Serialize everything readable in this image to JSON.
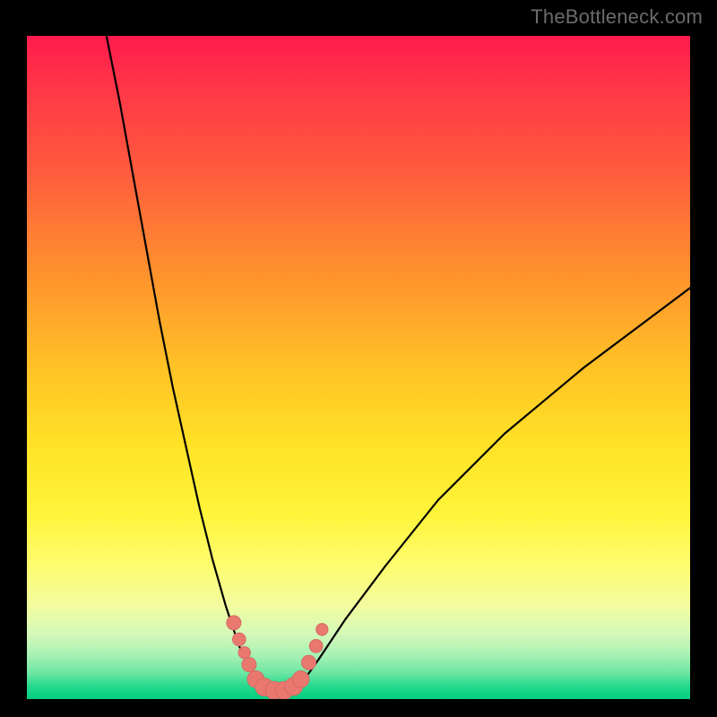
{
  "watermark": "TheBottleneck.com",
  "colors": {
    "curve": "#000000",
    "markers_fill": "#e9786f",
    "markers_stroke": "#d66a63",
    "background_black": "#000000"
  },
  "chart_data": {
    "type": "line",
    "title": "",
    "xlabel": "",
    "ylabel": "",
    "xlim": [
      0,
      100
    ],
    "ylim": [
      0,
      100
    ],
    "grid": false,
    "legend": false,
    "series": [
      {
        "name": "left-branch",
        "x": [
          12,
          14,
          16,
          18,
          20,
          22,
          24,
          26,
          28,
          30,
          31,
          32,
          33,
          34,
          34.5
        ],
        "y": [
          100,
          90,
          79,
          68,
          57,
          47,
          38,
          29,
          21,
          14,
          11,
          8,
          6,
          4,
          2.5
        ]
      },
      {
        "name": "valley-floor",
        "x": [
          34.5,
          36,
          38,
          40,
          41.5
        ],
        "y": [
          2.5,
          1.2,
          1.0,
          1.2,
          2.5
        ]
      },
      {
        "name": "right-branch",
        "x": [
          41.5,
          44,
          48,
          54,
          62,
          72,
          84,
          100
        ],
        "y": [
          2.5,
          6,
          12,
          20,
          30,
          40,
          50,
          62
        ]
      }
    ],
    "markers": [
      {
        "x": 31.2,
        "y": 11.5,
        "r": 1.2
      },
      {
        "x": 32.0,
        "y": 9.0,
        "r": 1.1
      },
      {
        "x": 32.8,
        "y": 7.0,
        "r": 1.0
      },
      {
        "x": 33.5,
        "y": 5.2,
        "r": 1.2
      },
      {
        "x": 34.5,
        "y": 3.0,
        "r": 1.4
      },
      {
        "x": 35.8,
        "y": 1.8,
        "r": 1.5
      },
      {
        "x": 37.3,
        "y": 1.3,
        "r": 1.5
      },
      {
        "x": 38.8,
        "y": 1.3,
        "r": 1.5
      },
      {
        "x": 40.2,
        "y": 1.9,
        "r": 1.5
      },
      {
        "x": 41.3,
        "y": 3.0,
        "r": 1.4
      },
      {
        "x": 42.5,
        "y": 5.5,
        "r": 1.2
      },
      {
        "x": 43.6,
        "y": 8.0,
        "r": 1.1
      },
      {
        "x": 44.5,
        "y": 10.5,
        "r": 1.0
      }
    ],
    "annotations": []
  }
}
